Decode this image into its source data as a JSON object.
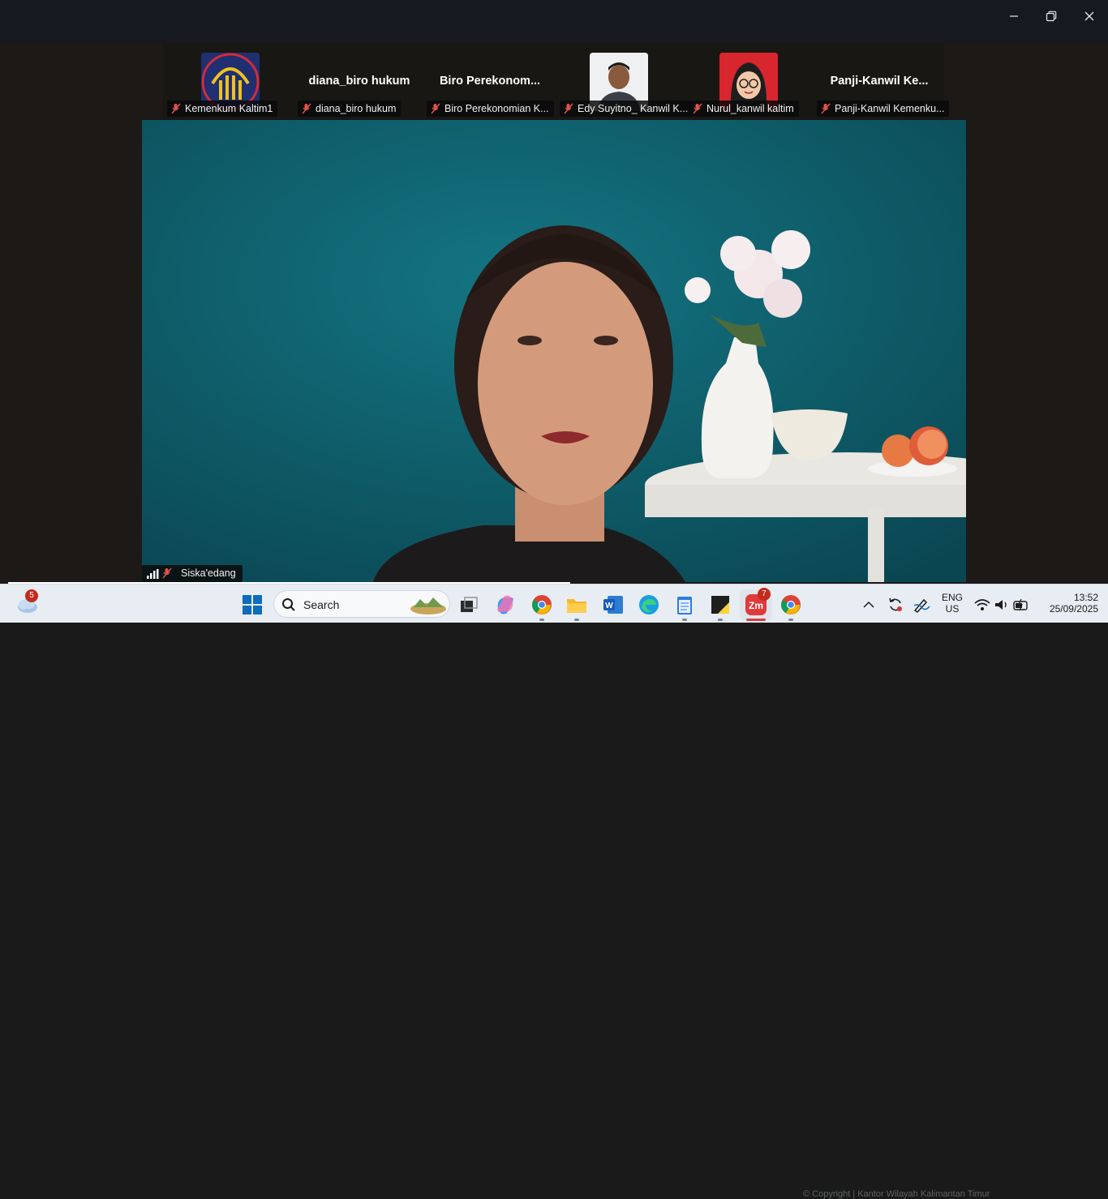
{
  "participants": [
    {
      "name": "Kemenkum Kaltim1",
      "avatar": "logo"
    },
    {
      "name": "diana_biro hukum",
      "display_name": "diana_biro hukum"
    },
    {
      "name": "Biro Perekonomian K...",
      "display_name": "Biro  Perekonom..."
    },
    {
      "name": "Edy Suyitno_ Kanwil K...",
      "avatar": "photo"
    },
    {
      "name": "Nurul_kanwil kaltim",
      "avatar": "cartoon"
    },
    {
      "name": "Panji-Kanwil Kemenku...",
      "display_name": "Panji-Kanwil  Ke..."
    }
  ],
  "active_speaker": {
    "name": "Siska'edang"
  },
  "taskbar": {
    "weather_badge": "5",
    "search_placeholder": "Search",
    "zoom_badge": "7",
    "lang_top": "ENG",
    "lang_bottom": "US",
    "time": "13:52",
    "date": "25/09/2025",
    "watermark": "© Copyright | Kantor Wilayah Kalimantan Timur"
  },
  "colors": {
    "accent": "#0f5f6c",
    "mute": "#e0524a",
    "badge": "#c42b1c"
  }
}
